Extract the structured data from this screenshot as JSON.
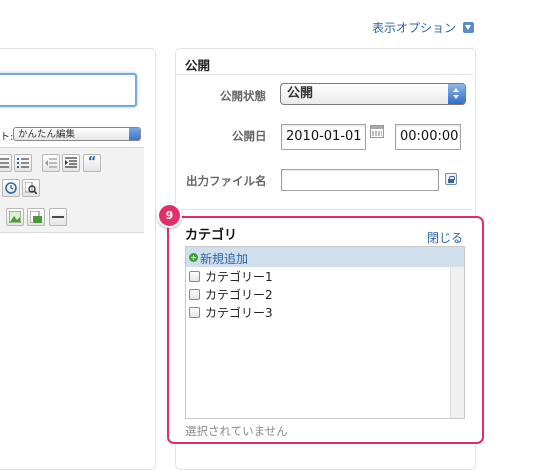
{
  "top": {
    "display_options_label": "表示オプション"
  },
  "editor": {
    "format_label": "ト:",
    "format_select_value": "かんたん編集",
    "toolbar": {
      "quote_label": "“"
    }
  },
  "publish": {
    "heading": "公開",
    "status_label": "公開状態",
    "status_value": "公開",
    "date_label": "公開日",
    "date_value": "2010-01-01",
    "time_value": "00:00:00",
    "filename_label": "出力ファイル名",
    "filename_value": ""
  },
  "category": {
    "badge_number": "9",
    "title": "カテゴリ",
    "close_label": "閉じる",
    "add_new_label": "新規追加",
    "items": [
      {
        "label": "カテゴリー1",
        "checked": false
      },
      {
        "label": "カテゴリー2",
        "checked": false
      },
      {
        "label": "カテゴリー3",
        "checked": false
      }
    ],
    "none_selected": "選択されていません"
  },
  "colors": {
    "highlight": "#e02c6a",
    "link": "#2c64a8",
    "add_new_bg": "#cfdfeb"
  }
}
